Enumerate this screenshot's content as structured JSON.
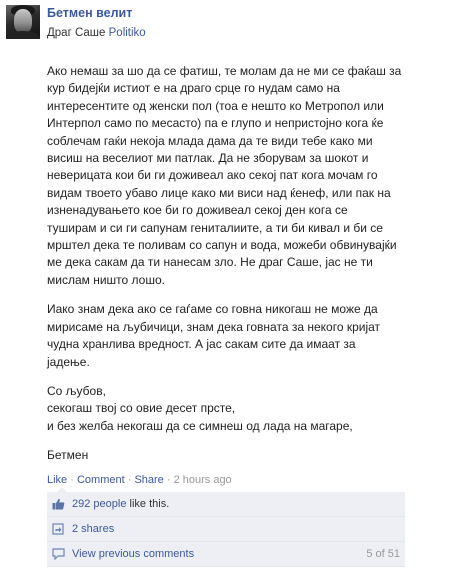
{
  "post": {
    "author": "Бетмен велит",
    "recipient_prefix": "Драг Саше",
    "recipient_link": "Politiko",
    "paragraphs": [
      "Ако немаш за шо да се фатиш, те молам да не ми се фаќаш за\nкур бидејќи истиот е на драго срце го нудам само на\nинтересентите од женски пол (тоа е нешто ко Метропол или\nИнтерпол само по месасто) па е глупо и непристојно кога ќе\nсоблечам гаќи некоја млада дама да те види тебе како ми\nвисиш на веселиот ми патлак. Да не зборувам за шокот и\nневерицата кои би ги доживеал ако секој пат кога мочам го\nвидам твоето убаво лице како ми виси над ќенеф, или пак на\nизненадувањето кое би го доживеал секој ден кога се\nтуширам и си ги сапунам гениталиите, а ти би кивал и би се\nмрштел дека те поливам со сапун и вода, можеби обвинувајќи\nме дека сакам да ти нанесам зло. Не драг Саше, јас не ти\nмислам ништо лошо.",
      "Иако знам дека ако се гаѓаме со говна никогаш не може да\nмирисаме на љубичици, знам дека говната за некого кријат\nчудна хранлива вредност. А јас сакам сите да имаат за\nјадење.",
      "Со љубов,\nсекогаш твој со овие десет прсте,\nи без желба некогаш да се симнеш од лада на магаре,",
      "Бетмен"
    ]
  },
  "actions": {
    "like": "Like",
    "comment": "Comment",
    "share": "Share",
    "separator": " · ",
    "time": "2 hours ago"
  },
  "ufi": {
    "likes_link": "292 people",
    "likes_suffix": " like this.",
    "shares": "2 shares",
    "view_comments": "View previous comments",
    "comment_count": "5 of 51"
  },
  "icons": {
    "like": "thumbs-up-icon",
    "share": "share-icon",
    "comments": "comment-bubble-icon"
  },
  "colors": {
    "link": "#3b5998",
    "ufi_bg": "#edeff4",
    "muted": "#999999"
  }
}
